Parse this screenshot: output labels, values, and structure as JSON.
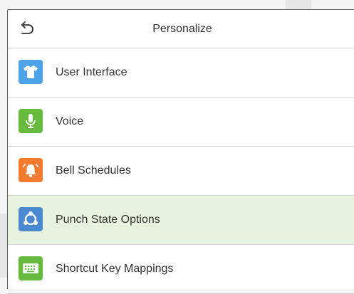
{
  "header": {
    "title": "Personalize",
    "back_icon": "back-arrow-icon"
  },
  "menu": {
    "selected_index": 3,
    "items": [
      {
        "label": "User Interface",
        "icon": "tshirt-icon",
        "color": "#4ea2e8"
      },
      {
        "label": "Voice",
        "icon": "microphone-icon",
        "color": "#66bb3f"
      },
      {
        "label": "Bell Schedules",
        "icon": "bell-icon",
        "color": "#f27b2f"
      },
      {
        "label": "Punch State Options",
        "icon": "punch-state-icon",
        "color": "#4a88d0"
      },
      {
        "label": "Shortcut Key Mappings",
        "icon": "keyboard-icon",
        "color": "#66bb3f"
      }
    ]
  },
  "colors": {
    "selected_background": "#e8f3df"
  }
}
